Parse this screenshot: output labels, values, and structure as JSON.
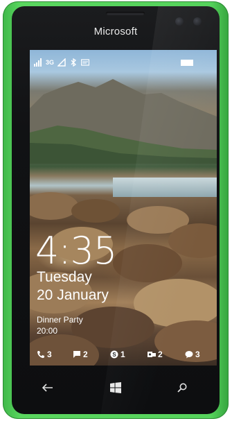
{
  "device": {
    "brand": "Microsoft",
    "shell_color": "#56d35c"
  },
  "status_bar": {
    "network": "3G"
  },
  "lock_screen": {
    "time": "4:35",
    "day": "Tuesday",
    "date": "20 January",
    "event": {
      "title": "Dinner Party",
      "time": "20:00"
    },
    "notifications": [
      {
        "icon": "phone-icon",
        "count": "3"
      },
      {
        "icon": "message-icon",
        "count": "2"
      },
      {
        "icon": "skype-icon",
        "count": "1"
      },
      {
        "icon": "outlook-icon",
        "count": "2"
      },
      {
        "icon": "chat-icon",
        "count": "3"
      }
    ]
  },
  "nav": {
    "back": "back-icon",
    "start": "windows-start-icon",
    "search": "search-icon"
  }
}
